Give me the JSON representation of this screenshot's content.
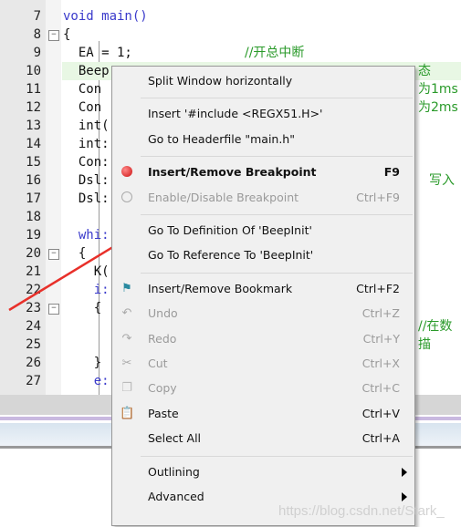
{
  "editor": {
    "lines": [
      {
        "n": "7",
        "code": "void main()",
        "kw": true
      },
      {
        "n": "8",
        "code": "{",
        "fold": "minus"
      },
      {
        "n": "9",
        "code": "  EA = 1;",
        "comment": "//开总中断"
      },
      {
        "n": "10",
        "code": "  Beep",
        "comment": "态",
        "highlight": true
      },
      {
        "n": "11",
        "code": "  Con",
        "comment": "为1ms"
      },
      {
        "n": "12",
        "code": "  Con",
        "comment": "为2ms"
      },
      {
        "n": "13",
        "code": "  int("
      },
      {
        "n": "14",
        "code": "  int:"
      },
      {
        "n": "15",
        "code": "  Con:"
      },
      {
        "n": "16",
        "code": "  Dsl:",
        "comment": "写入"
      },
      {
        "n": "17",
        "code": "  Dsl:"
      },
      {
        "n": "18",
        "code": ""
      },
      {
        "n": "19",
        "code": "  whi:",
        "kw": true
      },
      {
        "n": "20",
        "code": "  {",
        "fold": "minus"
      },
      {
        "n": "21",
        "code": "    K("
      },
      {
        "n": "22",
        "code": "    i:",
        "kw": true
      },
      {
        "n": "23",
        "code": "    {",
        "fold": "minus"
      },
      {
        "n": "24",
        "code": "",
        "comment": "//在数"
      },
      {
        "n": "25",
        "code": "",
        "comment": "描"
      },
      {
        "n": "26",
        "code": "    }"
      },
      {
        "n": "27",
        "code": "    e:",
        "kw": true
      }
    ]
  },
  "context_menu": {
    "items": [
      {
        "label": "Split Window horizontally",
        "shortcut": ""
      },
      {
        "sep": true
      },
      {
        "label": "Insert '#include <REGX51.H>'",
        "shortcut": ""
      },
      {
        "label": "Go to Headerfile \"main.h\"",
        "shortcut": ""
      },
      {
        "sep": true
      },
      {
        "label": "Insert/Remove Breakpoint",
        "shortcut": "F9",
        "icon": "breakpoint-icon",
        "bold": true
      },
      {
        "label": "Enable/Disable Breakpoint",
        "shortcut": "Ctrl+F9",
        "icon": "breakpoint-outline-icon",
        "disabled": true
      },
      {
        "sep": true
      },
      {
        "label": "Go To Definition Of 'BeepInit'",
        "shortcut": ""
      },
      {
        "label": "Go To Reference To 'BeepInit'",
        "shortcut": ""
      },
      {
        "sep": true
      },
      {
        "label": "Insert/Remove Bookmark",
        "shortcut": "Ctrl+F2",
        "icon": "bookmark-flag-icon"
      },
      {
        "label": "Undo",
        "shortcut": "Ctrl+Z",
        "icon": "undo-icon",
        "disabled": true
      },
      {
        "label": "Redo",
        "shortcut": "Ctrl+Y",
        "icon": "redo-icon",
        "disabled": true
      },
      {
        "label": "Cut",
        "shortcut": "Ctrl+X",
        "icon": "scissors-icon",
        "disabled": true
      },
      {
        "label": "Copy",
        "shortcut": "Ctrl+C",
        "icon": "copy-icon",
        "disabled": true
      },
      {
        "label": "Paste",
        "shortcut": "Ctrl+V",
        "icon": "clipboard-icon"
      },
      {
        "label": "Select All",
        "shortcut": "Ctrl+A"
      },
      {
        "sep": true
      },
      {
        "label": "Outlining",
        "submenu": true
      },
      {
        "label": "Advanced",
        "submenu": true
      }
    ]
  },
  "watermark": "https://blog.csdn.net/Stark_",
  "colors": {
    "annotation_arrow": "#e8302a",
    "breakpoint": "#d42020",
    "comment": "#2a9a2a",
    "keyword": "#3a3acb"
  }
}
